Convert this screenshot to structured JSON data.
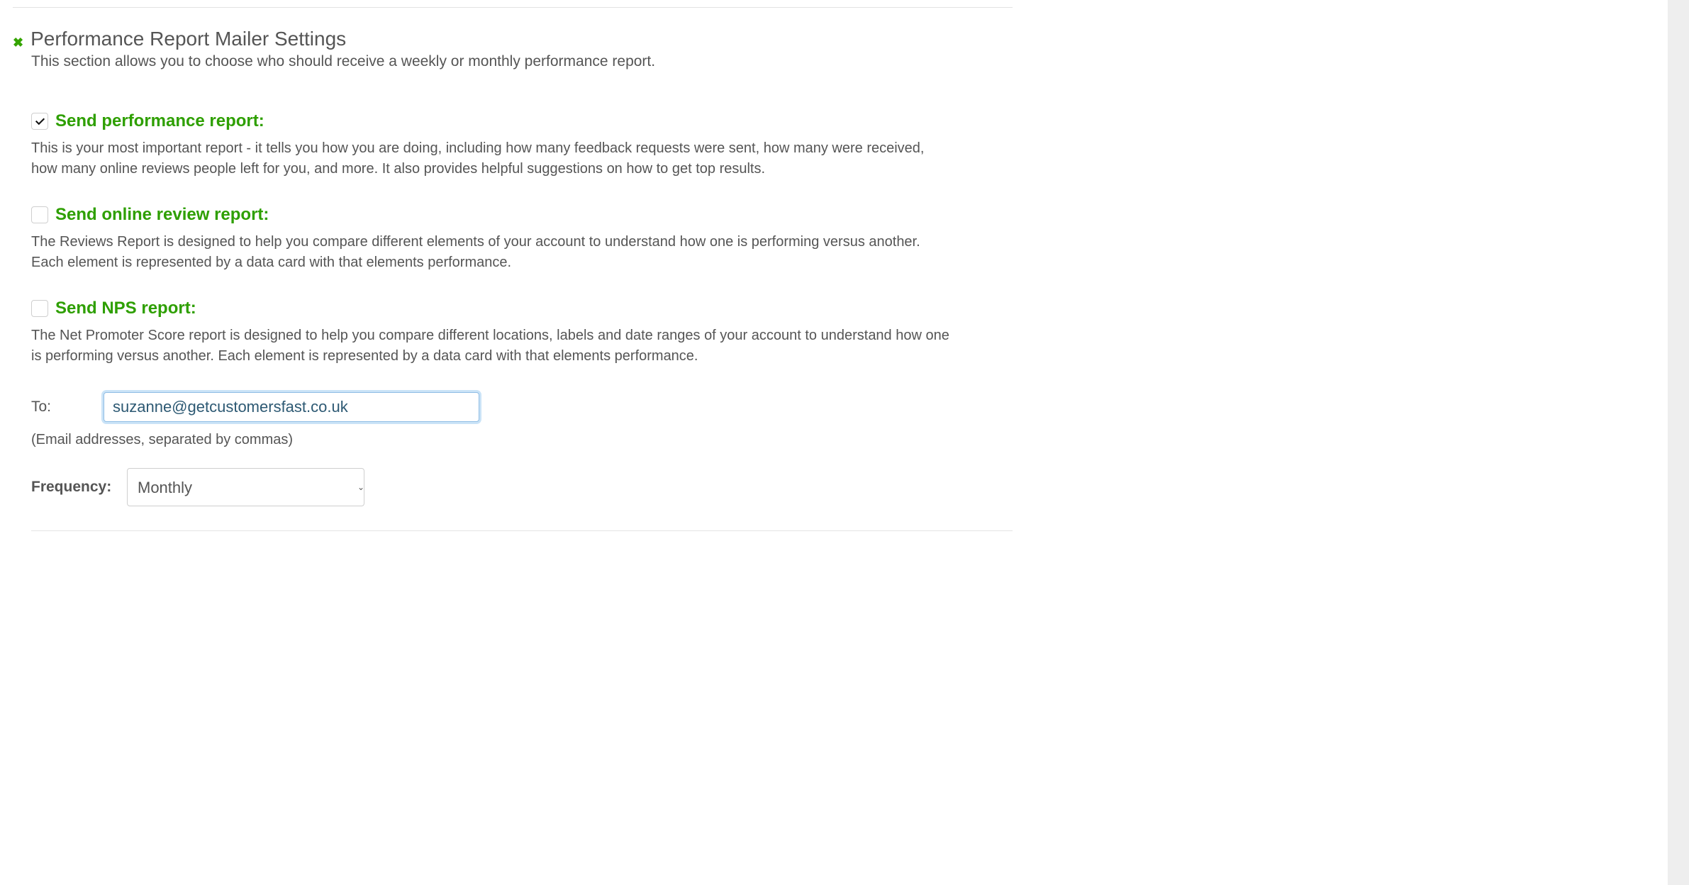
{
  "section": {
    "title": "Performance Report Mailer Settings",
    "subtitle": "This section allows you to choose who should receive a weekly or monthly performance report."
  },
  "options": {
    "performance": {
      "label": "Send performance report:",
      "description": "This is your most important report - it tells you how you are doing, including how many feedback requests were sent, how many were received, how many online reviews people left for you, and more. It also provides helpful suggestions on how to get top results.",
      "checked": true
    },
    "online_review": {
      "label": "Send online review report:",
      "description": "The Reviews Report is designed to help you compare different elements of your account to understand how one is performing versus another. Each element is represented by a data card with that elements performance.",
      "checked": false
    },
    "nps": {
      "label": "Send NPS report:",
      "description": "The Net Promoter Score report is designed to help you compare different locations, labels and date ranges of your account to understand how one is performing versus another. Each element is represented by a data card with that elements performance.",
      "checked": false
    }
  },
  "fields": {
    "to_label": "To:",
    "to_value": "suzanne@getcustomersfast.co.uk",
    "to_helper": "(Email addresses, separated by commas)",
    "frequency_label": "Frequency:",
    "frequency_value": "Monthly"
  }
}
